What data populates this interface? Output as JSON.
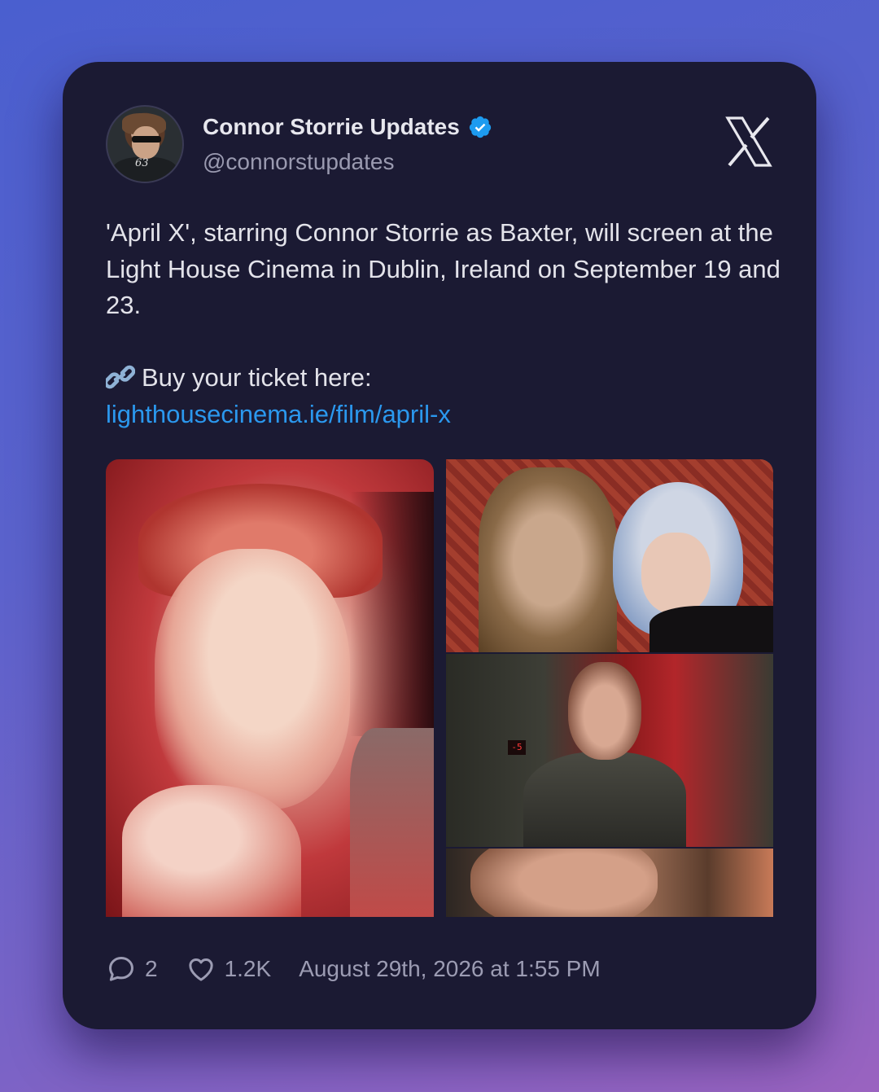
{
  "author": {
    "name": "Connor Storrie Updates",
    "handle": "@connorstupdates",
    "avatar_text": "63",
    "verified": true,
    "verified_color": "#1d9bf0"
  },
  "tweet": {
    "paragraph1": "'April X', starring Connor Storrie as Baxter, will screen at the Light House Cinema in Dublin, Ireland on September 19 and 23.",
    "emoji": "link-emoji",
    "cta": "Buy your ticket here:",
    "link": "lighthousecinema.ie/film/april-x",
    "link_color": "#2b98ee"
  },
  "media": {
    "elevator_panel": "-5"
  },
  "footer": {
    "replies": "2",
    "likes": "1.2K",
    "timestamp": "August 29th, 2026 at 1:55 PM"
  },
  "icons": {
    "brand": "x-logo-icon",
    "reply": "comment-icon",
    "like": "heart-icon",
    "verified": "verified-badge-icon"
  },
  "colors": {
    "card": "#1b1a33",
    "background_start": "#4a5fcf",
    "background_end": "#9a63c0"
  }
}
